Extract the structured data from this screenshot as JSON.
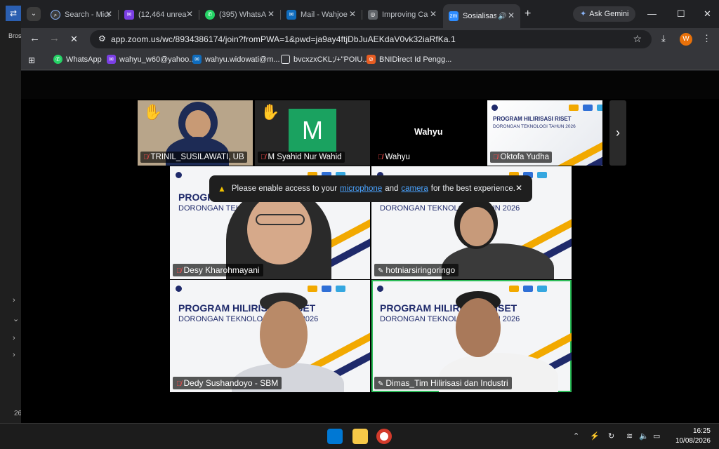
{
  "desktop": {
    "icon_label": "Bros",
    "side_number": "26"
  },
  "browser": {
    "tabs": [
      {
        "label": "Search - Micr",
        "icon": "search-icon",
        "color": "#3c3c3c"
      },
      {
        "label": "(12,464 unrea",
        "icon": "mail-icon",
        "color": "#7b3fe4"
      },
      {
        "label": "(395) WhatsA",
        "icon": "whatsapp-icon",
        "color": "#25d366"
      },
      {
        "label": "Mail - Wahjoe",
        "icon": "outlook-icon",
        "color": "#0f6cbd"
      },
      {
        "label": "Improving Ca",
        "icon": "globe-icon",
        "color": "#9aa0a6"
      },
      {
        "label": "Sosialisas",
        "icon": "zoom-icon",
        "color": "#2d8cff"
      }
    ],
    "gemini_label": "Ask Gemini",
    "url": "app.zoom.us/wc/8934386174/join?fromPWA=1&pwd=ja9ay4ftjDbJuAEKdaV0vk32iaRfKa.1",
    "profile_initial": "W",
    "bookmarks": [
      {
        "label": "WhatsApp",
        "icon": "whatsapp-icon",
        "color": "#25d366"
      },
      {
        "label": "wahyu_w60@yahoo...",
        "icon": "mail-icon",
        "color": "#7b3fe4"
      },
      {
        "label": "wahyu.widowati@m...",
        "icon": "outlook-icon",
        "color": "#0f6cbd"
      },
      {
        "label": "bvcxzxCKL;/+\"POIU...",
        "icon": "folder-icon",
        "color": "#9aa0a6"
      },
      {
        "label": "BNIDirect Id Pengg...",
        "icon": "bni-icon",
        "color": "#e85d22"
      }
    ]
  },
  "zoom": {
    "thumbnails": [
      {
        "name": "TRINIL_SUSILAWATI, UB",
        "hand": "✋"
      },
      {
        "name": "M Syahid Nur Wahid",
        "hand": "✋",
        "avatar": "M"
      },
      {
        "name": "Wahyu",
        "display_name": "Wahyu"
      },
      {
        "name": "Oktofa Yudha"
      }
    ],
    "slide": {
      "title": "PROGRAM HILIRISASI RISET",
      "subtitle": "DORONGAN TEKNOLOGI TAHUN 2026",
      "tile_title": "PROGRAM HILIRISASI RISET",
      "tile_subtitle": "DORONGAN TEKNOLOGI TAHUN 2026"
    },
    "tiles": [
      {
        "name": "Desy Kharohmayani"
      },
      {
        "name": "hotniarsiringoringo"
      },
      {
        "name": "Dedy Sushandoyo - SBM"
      },
      {
        "name": "Dimas_Tim Hilirisasi dan Industri"
      }
    ],
    "notice": {
      "before": "Please enable access to your",
      "link1": "microphone",
      "middle": "and",
      "link2": "camera",
      "after": "for the best experience."
    }
  },
  "taskbar": {
    "time": "16:25",
    "date": "10/08/2026"
  }
}
